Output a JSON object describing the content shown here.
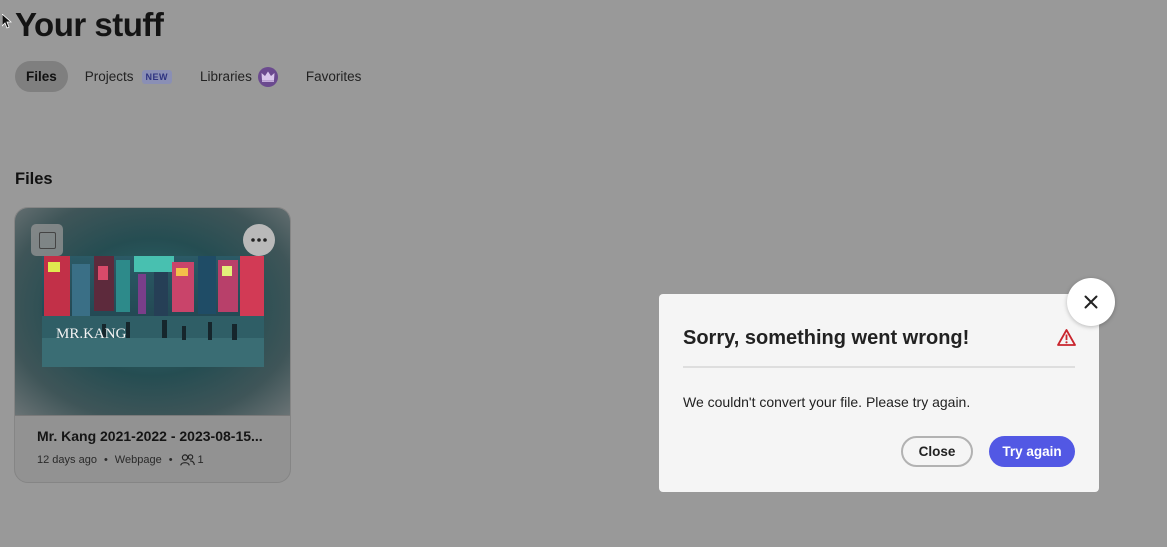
{
  "page": {
    "title": "Your stuff"
  },
  "tabs": [
    {
      "label": "Files",
      "active": true
    },
    {
      "label": "Projects",
      "badge": "NEW"
    },
    {
      "label": "Libraries",
      "icon": "crown-icon"
    },
    {
      "label": "Favorites"
    }
  ],
  "files_section": {
    "title": "Files",
    "cards": [
      {
        "name": "Mr. Kang 2021-2022 - 2023-08-15...",
        "modified": "12 days ago",
        "type": "Webpage",
        "collaborators": "1",
        "thumbnail_text": "MR.KANG"
      }
    ]
  },
  "dialog": {
    "title": "Sorry, something went wrong!",
    "message": "We couldn't convert your file. Please try again.",
    "close_label": "Close",
    "retry_label": "Try again"
  },
  "colors": {
    "overlay": "#999999",
    "primary": "#5258e4",
    "alert": "#c9252d",
    "badge_bg": "#8a8fb5",
    "crown_bg": "#6b4a8f"
  }
}
